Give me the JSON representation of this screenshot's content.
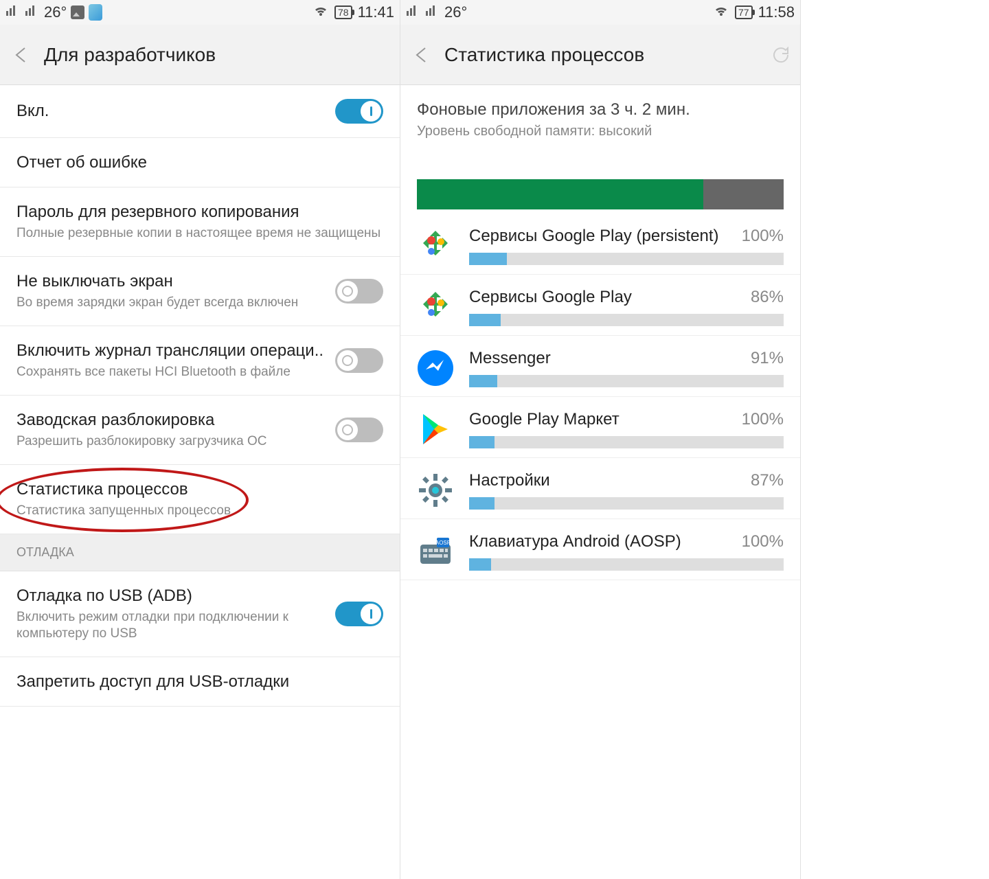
{
  "left": {
    "status": {
      "temp": "26°",
      "battery": "78",
      "time": "11:41"
    },
    "header_title": "Для разработчиков",
    "items": [
      {
        "primary": "Вкл.",
        "secondary": "",
        "toggle": "on"
      },
      {
        "primary": "Отчет об ошибке",
        "secondary": ""
      },
      {
        "primary": "Пароль для резервного копирования",
        "secondary": "Полные резервные копии в настоящее время не защищены"
      },
      {
        "primary": "Не выключать экран",
        "secondary": "Во время зарядки экран будет всегда включен",
        "toggle": "off"
      },
      {
        "primary": "Включить журнал трансляции операци..",
        "secondary": "Сохранять все пакеты HCI Bluetooth в файле",
        "toggle": "off"
      },
      {
        "primary": "Заводская разблокировка",
        "secondary": "Разрешить разблокировку загрузчика ОС",
        "toggle": "off"
      },
      {
        "primary": "Статистика процессов",
        "secondary": "Статистика запущенных процессов"
      }
    ],
    "section_debug": "ОТЛАДКА",
    "debug_items": [
      {
        "primary": "Отладка по USB (ADB)",
        "secondary": "Включить режим отладки при подключении к компьютеру по USB",
        "toggle": "on"
      },
      {
        "primary": "Запретить доступ для USB-отладки",
        "secondary": ""
      }
    ]
  },
  "right": {
    "status": {
      "temp": "26°",
      "battery": "77",
      "time": "11:58"
    },
    "header_title": "Статистика процессов",
    "summary_title": "Фоновые приложения за 3 ч. 2 мин.",
    "summary_sub": "Уровень свободной памяти: высокий",
    "mem_fill_pct": 78,
    "processes": [
      {
        "name": "Сервисы Google Play (persistent)",
        "pct": "100%",
        "bar": 12,
        "icon": "play-services"
      },
      {
        "name": "Сервисы Google Play",
        "pct": "86%",
        "bar": 10,
        "icon": "play-services"
      },
      {
        "name": "Messenger",
        "pct": "91%",
        "bar": 9,
        "icon": "messenger"
      },
      {
        "name": "Google Play Маркет",
        "pct": "100%",
        "bar": 8,
        "icon": "play-store"
      },
      {
        "name": "Настройки",
        "pct": "87%",
        "bar": 8,
        "icon": "settings"
      },
      {
        "name": "Клавиатура Android (AOSP)",
        "pct": "100%",
        "bar": 7,
        "icon": "keyboard"
      }
    ]
  }
}
